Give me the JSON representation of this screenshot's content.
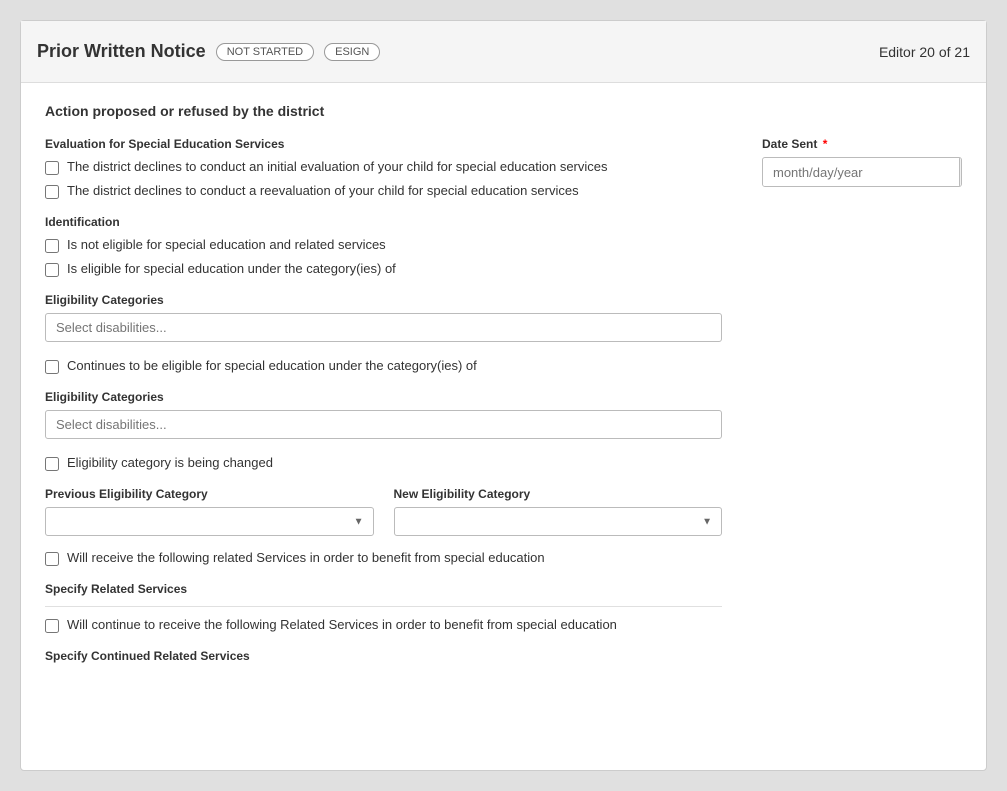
{
  "header": {
    "title": "Prior Written Notice",
    "status_badge": "NOT STARTED",
    "esign_badge": "ESIGN",
    "editor_info": "Editor 20 of 21"
  },
  "section": {
    "title": "Action proposed or refused by the district"
  },
  "evaluation": {
    "subsection_label": "Evaluation for Special Education Services",
    "checkbox1": "The district declines to conduct an initial evaluation of your child for special education services",
    "checkbox2": "The district declines to conduct a reevaluation of your child for special education services"
  },
  "date_sent": {
    "label": "Date Sent",
    "placeholder": "month/day/year"
  },
  "identification": {
    "subsection_label": "Identification",
    "checkbox1": "Is not eligible for special education and related services",
    "checkbox2": "Is eligible for special education under the category(ies) of"
  },
  "eligibility_categories_1": {
    "label": "Eligibility Categories",
    "placeholder": "Select disabilities..."
  },
  "continues_checkbox": "Continues to be eligible for special education under the category(ies) of",
  "eligibility_categories_2": {
    "label": "Eligibility Categories",
    "placeholder": "Select disabilities..."
  },
  "eligibility_change_checkbox": "Eligibility category is being changed",
  "previous_eligibility": {
    "label": "Previous Eligibility Category"
  },
  "new_eligibility": {
    "label": "New Eligibility Category"
  },
  "related_services_checkbox": "Will receive the following related Services in order to benefit from special education",
  "specify_related_services": {
    "label": "Specify Related Services"
  },
  "continued_services_checkbox": "Will continue to receive the following Related Services in order to benefit from special education",
  "specify_continued_services": {
    "label": "Specify Continued Related Services"
  }
}
